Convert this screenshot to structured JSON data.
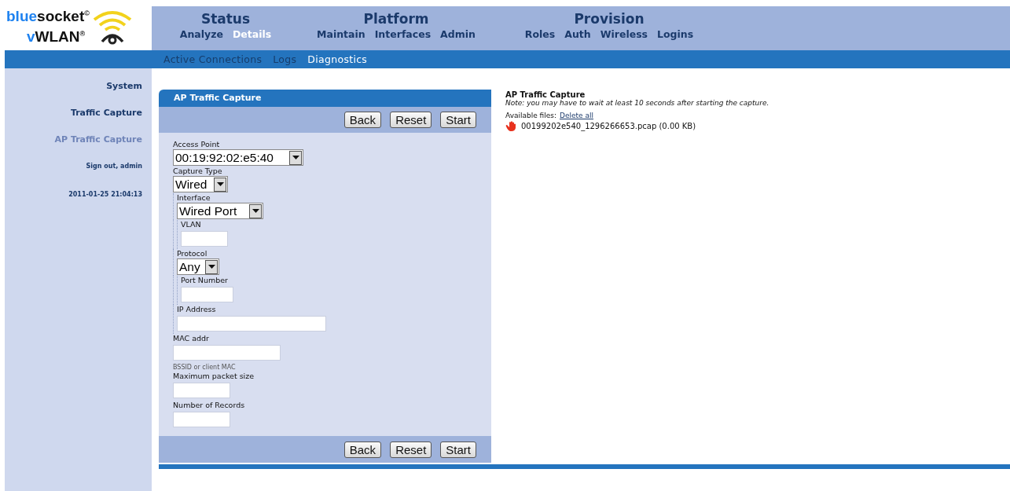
{
  "logo": {
    "line1_accent": "blue",
    "line1_rest": "socket",
    "line1_mark": "©",
    "line2_accent": "v",
    "line2_rest": "WLAN",
    "line2_mark": "®"
  },
  "nav_groups": [
    {
      "title": "Status",
      "items": [
        {
          "label": "Analyze",
          "selected": false
        },
        {
          "label": "Details",
          "selected": true
        }
      ]
    },
    {
      "title": "Platform",
      "items": [
        {
          "label": "Maintain",
          "selected": false
        },
        {
          "label": "Interfaces",
          "selected": false
        },
        {
          "label": "Admin",
          "selected": false
        }
      ]
    },
    {
      "title": "Provision",
      "items": [
        {
          "label": "Roles",
          "selected": false
        },
        {
          "label": "Auth",
          "selected": false
        },
        {
          "label": "Wireless",
          "selected": false
        },
        {
          "label": "Logins",
          "selected": false
        }
      ]
    }
  ],
  "subnav": [
    {
      "label": "Active Connections",
      "selected": false
    },
    {
      "label": "Logs",
      "selected": false
    },
    {
      "label": "Diagnostics",
      "selected": true
    }
  ],
  "sidebar": {
    "items": [
      {
        "label": "System",
        "selected": false
      },
      {
        "label": "Traffic Capture",
        "selected": false
      },
      {
        "label": "AP Traffic Capture",
        "selected": true
      }
    ],
    "sign_out": "Sign out, admin",
    "datetime": "2011-01-25 21:04:13"
  },
  "panel": {
    "title": "AP Traffic Capture",
    "buttons": [
      "Back",
      "Reset",
      "Start"
    ],
    "fields": [
      {
        "label": "Access Point",
        "kind": "select",
        "value": "00:19:92:02:e5:40"
      },
      {
        "label": "Capture Type",
        "kind": "select",
        "value": "Wired",
        "children": [
          {
            "label": "Interface",
            "kind": "select",
            "value": "Wired Port",
            "children": [
              {
                "label": "VLAN",
                "kind": "input"
              }
            ]
          },
          {
            "label": "Protocol",
            "kind": "select",
            "value": "Any",
            "children": [
              {
                "label": "Port Number",
                "kind": "input"
              }
            ]
          },
          {
            "label": "IP Address",
            "kind": "input"
          }
        ]
      },
      {
        "label": "MAC addr",
        "kind": "input",
        "hint": "BSSID or client MAC"
      },
      {
        "label": "Maximum packet size",
        "kind": "input"
      },
      {
        "label": "Number of Records",
        "kind": "input"
      }
    ],
    "bottom_buttons": [
      "Back",
      "Reset",
      "Start"
    ]
  },
  "info": {
    "title": "AP Traffic Capture",
    "note": "Note: you may have to wait at least 10 seconds after starting the capture.",
    "files_label": "Available files:",
    "delete_all": "Delete all",
    "files": [
      "00199202e540_1296266653.pcap (0.00 KB)"
    ]
  }
}
